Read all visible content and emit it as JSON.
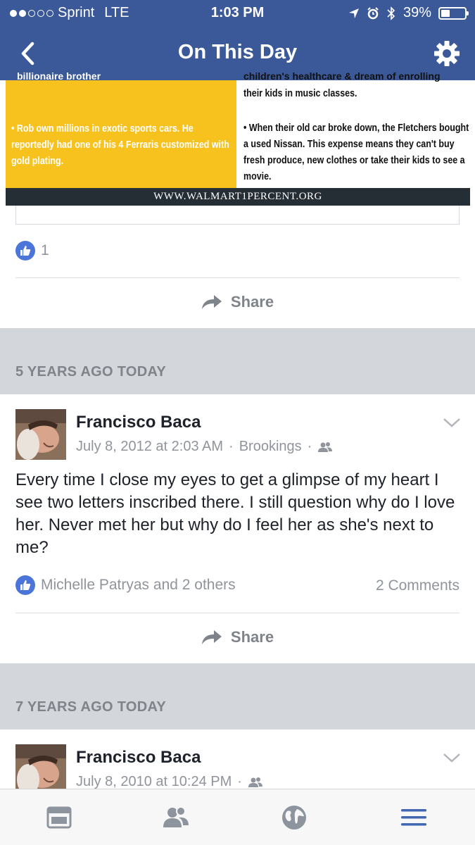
{
  "status_bar": {
    "carrier": "Sprint",
    "network": "LTE",
    "time": "1:03 PM",
    "battery": "39%",
    "battery_level": 0.39,
    "signal_bars": 2
  },
  "nav": {
    "title": "On This Day",
    "back_icon": "chevron-left-icon",
    "settings_icon": "gear-icon"
  },
  "image_post": {
    "infographic": {
      "left_cut_text": "billionaire brother",
      "left_text": "• Rob own millions in exotic sports cars. He reportedly had one of his 4 Ferraris customized with gold plating.",
      "right_cut_text": "children's healthcare & dream of enrolling",
      "right_top_text": "their kids in music classes.",
      "right_text": "• When their old car broke down, the Fletchers bought a used Nissan. This expense means they can't buy fresh produce, new clothes or take their kids to see a movie.",
      "footer": "WWW.WALMART1PERCENT.ORG",
      "left_color": "#f7c21e",
      "footer_color": "#262e35"
    },
    "like_count": "1",
    "share_label": "Share"
  },
  "sections": [
    {
      "header": "5 YEARS AGO TODAY",
      "post": {
        "author": "Francisco Baca",
        "date": "July 8, 2012 at 2:03 AM",
        "location": "Brookings",
        "privacy_icon": "friends-icon",
        "text": "Every time I  close my eyes to get a glimpse of my heart I see two letters inscribed there.  I still question why do I love her.  Never met her but why do I feel her as she's next to me?",
        "likes": "Michelle Patryas and 2 others",
        "comments": "2 Comments",
        "share_label": "Share"
      }
    },
    {
      "header": "7 YEARS AGO TODAY",
      "post": {
        "author": "Francisco Baca",
        "date": "July 8, 2010 at 10:24 PM",
        "privacy_icon": "friends-icon"
      }
    }
  ],
  "tabbar": {
    "items": [
      "news-feed-icon",
      "friends-icon",
      "globe-icon",
      "menu-icon"
    ],
    "active_color": "#4267b2",
    "inactive_color": "#8d949e"
  },
  "colors": {
    "brand": "#3b5998",
    "like_blue": "#4c75d9",
    "section_bg": "#d3d6db"
  }
}
